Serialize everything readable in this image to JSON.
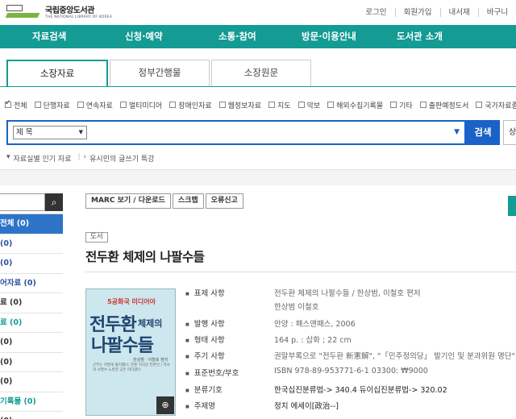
{
  "header": {
    "logo_ko": "국립중앙도서관",
    "logo_en": "THE NATIONAL LIBRARY OF KOREA",
    "util": [
      "로그인",
      "회원가입",
      "내서재",
      "바구니"
    ]
  },
  "gnav": [
    "자료검색",
    "신청·예약",
    "소통·참여",
    "방문·이용안내",
    "도서관 소개"
  ],
  "tabs": [
    "소장자료",
    "정부간행물",
    "소장원문"
  ],
  "filters": [
    {
      "label": "전체",
      "checked": true
    },
    {
      "label": "단행자료",
      "checked": false
    },
    {
      "label": "연속자료",
      "checked": false
    },
    {
      "label": "멀티미디어",
      "checked": false
    },
    {
      "label": "장애인자료",
      "checked": false
    },
    {
      "label": "웹정보자료",
      "checked": false
    },
    {
      "label": "지도",
      "checked": false
    },
    {
      "label": "악보",
      "checked": false
    },
    {
      "label": "해외수집기록물",
      "checked": false
    },
    {
      "label": "기타",
      "checked": false
    },
    {
      "label": "출판예정도서",
      "checked": false
    },
    {
      "label": "국가자료종합목록",
      "checked": false
    }
  ],
  "search": {
    "field_select": "제 목",
    "button": "검색",
    "button2": "상"
  },
  "links": [
    "자료실별 인기 자료",
    "유시민의 글쓰기 특강"
  ],
  "sidebar": [
    "전체 (0)",
    "(0)",
    "(0)",
    "어자료 (0)",
    "료 (0)",
    "료 (0)",
    "(0)",
    "(0)",
    "(0)",
    "기록물 (0)",
    "(0)"
  ],
  "actions": [
    "MARC 보기 / 다운로드",
    "스크랩",
    "오류신고"
  ],
  "record": {
    "badge": "도서",
    "title": "전두환 체제의 나팔수들",
    "cover": {
      "top": "5공화국 미디어아",
      "w1": "전두환",
      "w2": "체제의",
      "w3": "나팔수들",
      "authors": "한상범 · 이철호 편저",
      "blurb": "군부는 어떻게 통치했나, 언론 지식인 언론인 / 역사의 나팔수 노릇한 곳은 어디였나",
      "publisher": "패스"
    },
    "fields": [
      {
        "label": "표제 사항",
        "value": "전두환 체제의 나팔수들 / 한상범, 이철호 편저"
      },
      {
        "label": "",
        "value": "한상범    이철호"
      },
      {
        "label": "발행 사항",
        "value": "안양 : 패스앤패스, 2006"
      },
      {
        "label": "형태 사항",
        "value": "164 p. : 삽화 ; 22 cm"
      },
      {
        "label": "주기 사항",
        "value": "권말부록으로 \"전두환 新憲解\", \"「민주정의당」 발기인 및 분과위원 명단\" 수록"
      },
      {
        "label": "표준번호/부호",
        "value": "ISBN 978-89-953771-6-1 03300: ₩9000"
      },
      {
        "label": "분류기호",
        "value": "한국십진분류법-> 340.4   듀이십진분류법-> 320.02"
      },
      {
        "label": "주제명",
        "value": "정치 에세이[政治--]"
      }
    ]
  }
}
